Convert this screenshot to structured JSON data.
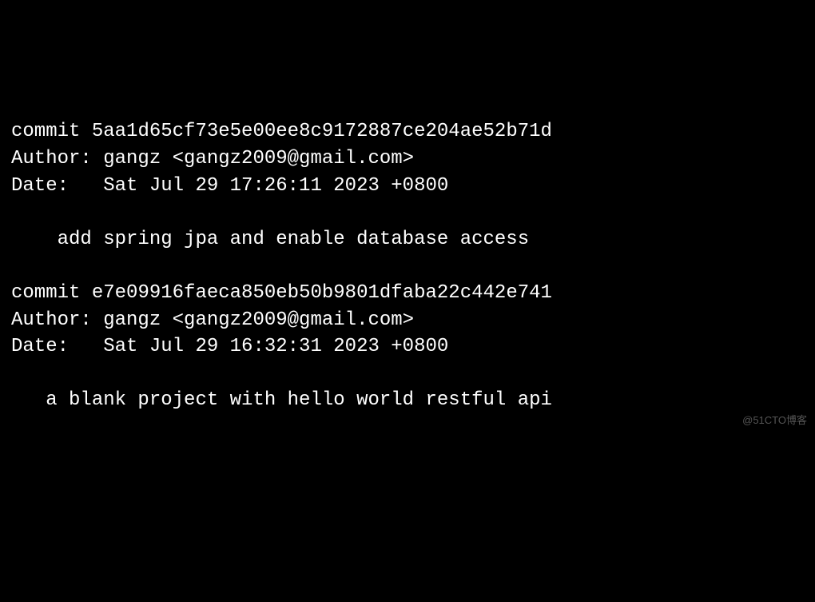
{
  "commits": [
    {
      "commit_label": "commit ",
      "hash": "5aa1d65cf73e5e00ee8c9172887ce204ae52b71d",
      "author_label": "Author: ",
      "author": "gangz <gangz2009@gmail.com>",
      "date_label": "Date:   ",
      "date": "Sat Jul 29 17:26:11 2023 +0800",
      "message": "    add spring jpa and enable database access"
    },
    {
      "commit_label": "commit ",
      "hash": "e7e09916faeca850eb50b9801dfaba22c442e741",
      "author_label": "Author: ",
      "author": "gangz <gangz2009@gmail.com>",
      "date_label": "Date:   ",
      "date": "Sat Jul 29 16:32:31 2023 +0800",
      "message": "   a blank project with hello world restful api"
    }
  ],
  "watermark": "@51CTO博客"
}
